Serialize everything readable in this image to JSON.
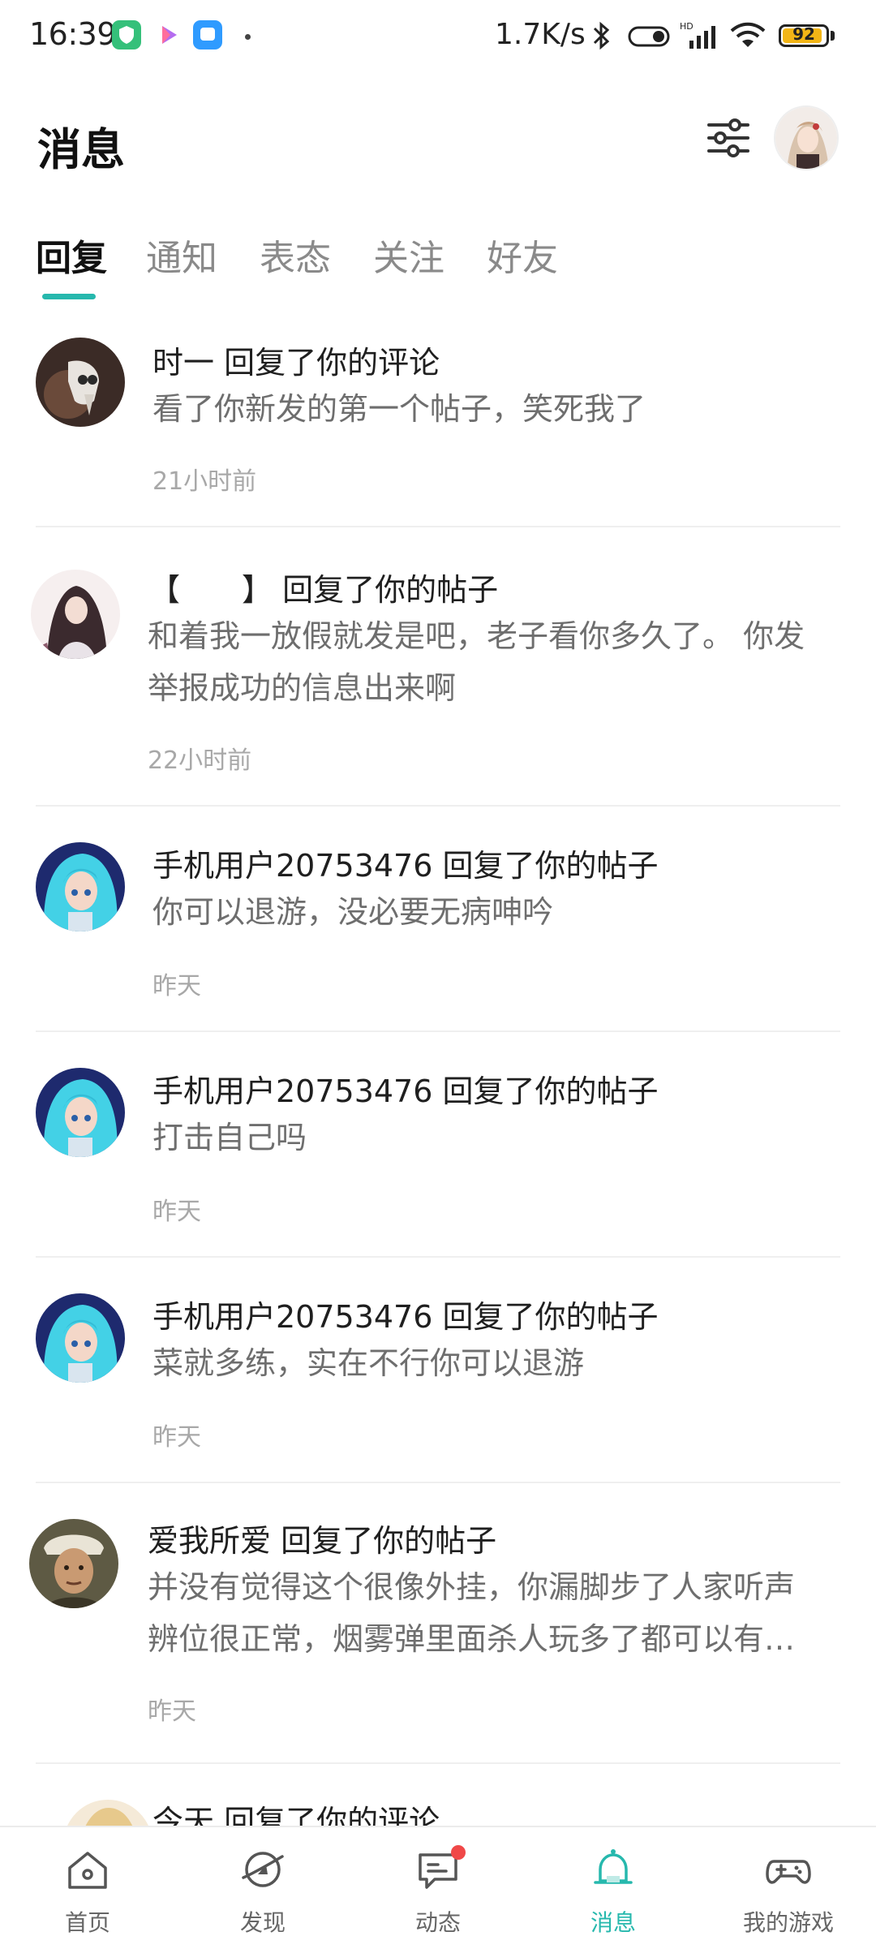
{
  "status_bar": {
    "time": "16:39",
    "net_speed": "1.7K/s",
    "battery": "92",
    "battery_level": 0.92
  },
  "header": {
    "title": "消息"
  },
  "tabs": [
    {
      "label": "回复",
      "active": true
    },
    {
      "label": "通知",
      "active": false
    },
    {
      "label": "表态",
      "active": false
    },
    {
      "label": "关注",
      "active": false
    },
    {
      "label": "好友",
      "active": false
    }
  ],
  "items": [
    {
      "title": "时一 回复了你的评论",
      "content": "看了你新发的第一个帖子，笑死我了",
      "time": "21小时前"
    },
    {
      "title": "【　　】 回复了你的帖子",
      "content": "和着我一放假就发是吧，老子看你多久了。 你发举报成功的信息出来啊",
      "time": "22小时前"
    },
    {
      "title": "手机用户20753476 回复了你的帖子",
      "content": "你可以退游，没必要无病呻吟",
      "time": "昨天"
    },
    {
      "title": "手机用户20753476 回复了你的帖子",
      "content": "打击自己吗",
      "time": "昨天"
    },
    {
      "title": "手机用户20753476 回复了你的帖子",
      "content": "菜就多练，实在不行你可以退游",
      "time": "昨天"
    },
    {
      "title": "爱我所爱 回复了你的帖子",
      "content": "并没有觉得这个很像外挂，你漏脚步了人家听声辨位很正常，烟雾弹里面杀人玩多了都可以有…",
      "time": "昨天"
    },
    {
      "title": "今天 回复了你的评论",
      "content": "",
      "time": ""
    }
  ],
  "bottom_nav": [
    {
      "label": "首页",
      "icon": "home-icon",
      "active": false
    },
    {
      "label": "发现",
      "icon": "discover-icon",
      "active": false
    },
    {
      "label": "动态",
      "icon": "feed-icon",
      "active": false,
      "badge": true
    },
    {
      "label": "消息",
      "icon": "bell-icon",
      "active": true
    },
    {
      "label": "我的游戏",
      "icon": "gamepad-icon",
      "active": false
    }
  ],
  "colors": {
    "accent": "#26b8ad",
    "badge": "#f04848",
    "battery": "#f2b516"
  }
}
